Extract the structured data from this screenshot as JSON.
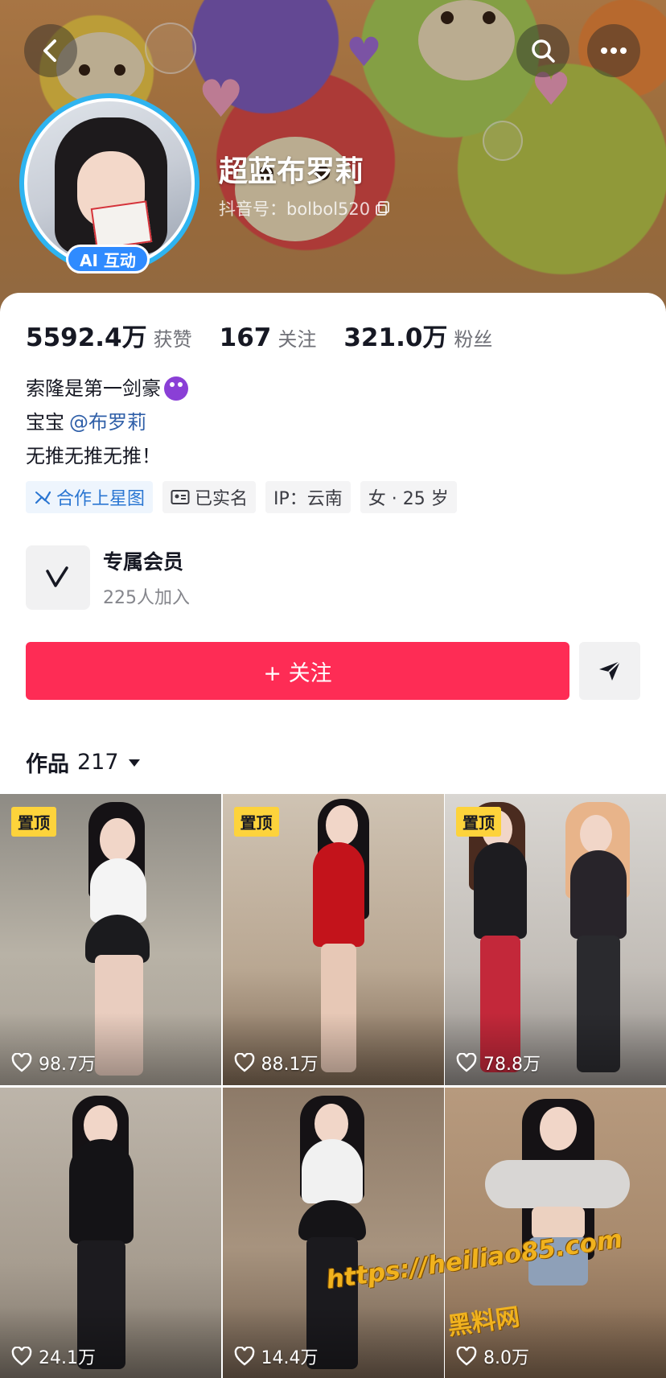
{
  "header": {
    "nickname": "超蓝布罗莉",
    "douyin_id": "抖音号：bolbol520",
    "ai_badge": "AI 互动"
  },
  "stats": [
    {
      "num": "5592.4万",
      "label": "获赞"
    },
    {
      "num": "167",
      "label": "关注"
    },
    {
      "num": "321.0万",
      "label": "粉丝"
    }
  ],
  "bio": {
    "line1": "索隆是第一剑豪",
    "line2_prefix": "宝宝",
    "line2_mention": "@布罗莉",
    "line3": "无推无推无推！"
  },
  "tags": [
    {
      "label": "合作上星图",
      "icon": "star-chart-icon"
    },
    {
      "label": "已实名",
      "icon": "id-card-icon"
    },
    {
      "label": "IP：云南"
    },
    {
      "label": "女 · 25 岁"
    }
  ],
  "member": {
    "title": "专属会员",
    "subtitle": "225人加入"
  },
  "follow_label": "+ 关注",
  "works": {
    "label": "作品",
    "count": "217"
  },
  "videos": [
    {
      "likes": "98.7万",
      "pinned": "置顶"
    },
    {
      "likes": "88.1万",
      "pinned": "置顶"
    },
    {
      "likes": "78.8万",
      "pinned": "置顶"
    },
    {
      "likes": "24.1万"
    },
    {
      "likes": "14.4万"
    },
    {
      "likes": "8.0万"
    }
  ],
  "watermark": {
    "url": "https://heiliao85.com",
    "name": "黑料网"
  },
  "colors": {
    "follow": "#fe2c55",
    "avatar_ring": "#2fb4f0",
    "pinned_badge": "#fdd33b",
    "mention": "#2f5fa8"
  }
}
